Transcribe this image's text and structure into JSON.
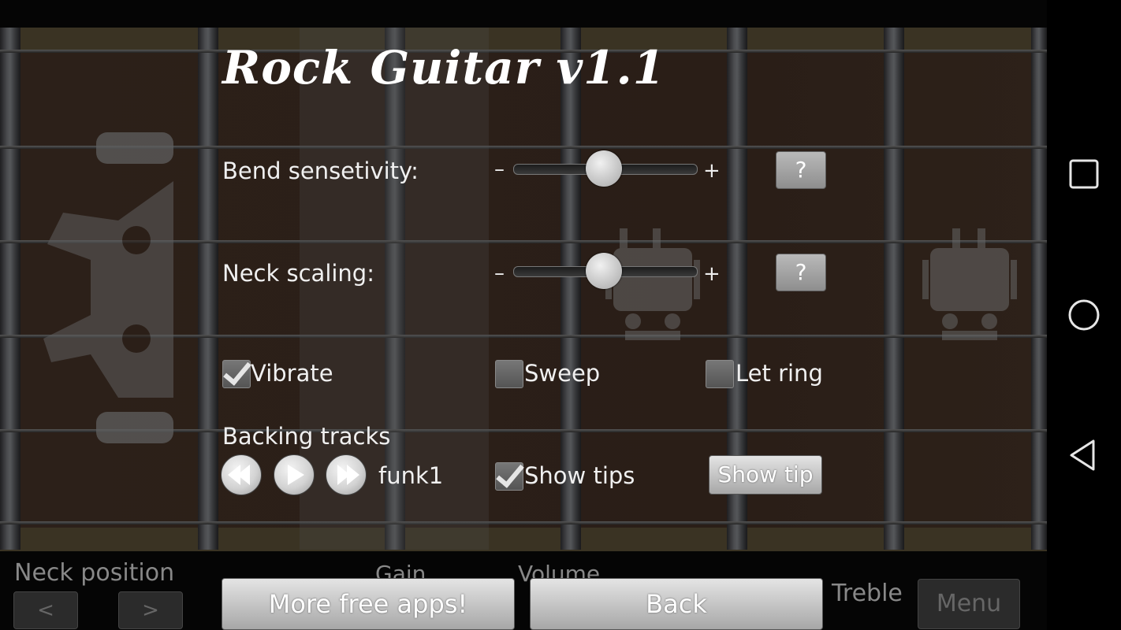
{
  "app": {
    "title": "Rock Guitar v1.1"
  },
  "settings": {
    "bend": {
      "label": "Bend sensetivity:",
      "value": 0.48,
      "minus": "–",
      "plus": "+",
      "help": "?"
    },
    "neck": {
      "label": "Neck scaling:",
      "value": 0.48,
      "minus": "–",
      "plus": "+",
      "help": "?"
    },
    "checkboxes": [
      {
        "label": "Vibrate",
        "checked": true
      },
      {
        "label": "Sweep",
        "checked": false
      },
      {
        "label": "Let ring",
        "checked": false
      }
    ],
    "backing": {
      "label": "Backing tracks",
      "track": "funk1",
      "show_tips_label": "Show tips",
      "show_tips_checked": true,
      "show_tip_button": "Show tip"
    }
  },
  "bottom": {
    "neck_position_label": "Neck position",
    "prev": "<",
    "next": ">",
    "gain_label": "Gain",
    "volume_label": "Volume",
    "treble_label": "Treble",
    "more_apps": "More free apps!",
    "back": "Back",
    "menu": "Menu"
  },
  "colors": {
    "fretboard": "#2b1f18",
    "fret_metal": "#4b4c4f",
    "button_gray": "#b9b9b9"
  }
}
